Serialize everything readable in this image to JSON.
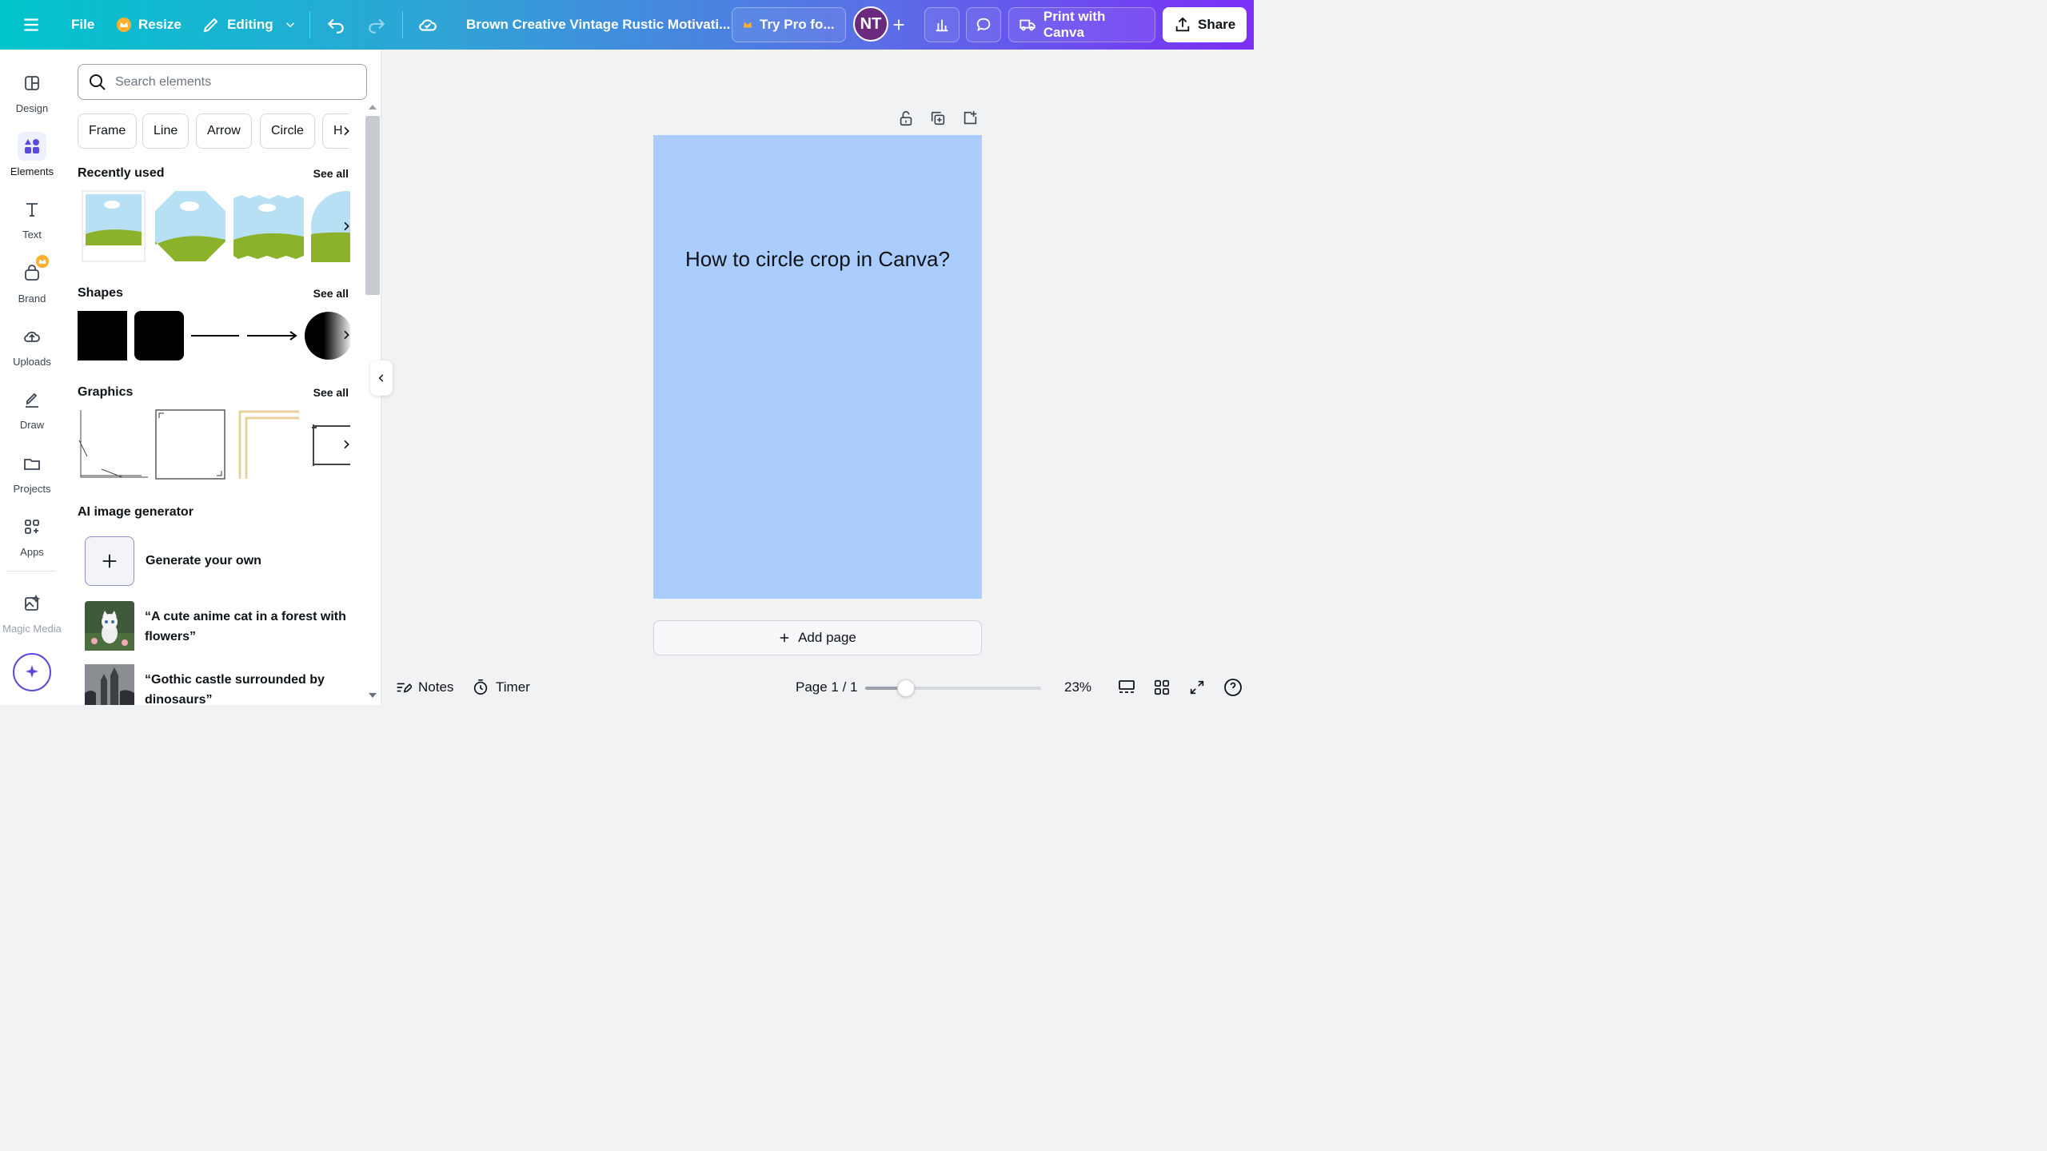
{
  "topbar": {
    "file_label": "File",
    "resize_label": "Resize",
    "editing_label": "Editing",
    "doc_title": "Brown Creative Vintage Rustic Motivati...",
    "try_pro_label": "Try Pro fo...",
    "avatar_initials": "NT",
    "print_label": "Print with Canva",
    "share_label": "Share",
    "accent_gradient": [
      "#00c4cc",
      "#7b2ff7"
    ]
  },
  "rail": {
    "items": [
      {
        "label": "Design",
        "icon": "layout-icon"
      },
      {
        "label": "Elements",
        "icon": "elements-icon"
      },
      {
        "label": "Text",
        "icon": "text-icon"
      },
      {
        "label": "Brand",
        "icon": "brand-icon"
      },
      {
        "label": "Uploads",
        "icon": "upload-cloud-icon"
      },
      {
        "label": "Draw",
        "icon": "pen-icon"
      },
      {
        "label": "Projects",
        "icon": "folder-icon"
      },
      {
        "label": "Apps",
        "icon": "apps-icon"
      },
      {
        "label": "Magic Media",
        "icon": "magic-media-icon"
      }
    ]
  },
  "panel": {
    "search_placeholder": "Search elements",
    "chips": [
      "Frame",
      "Line",
      "Arrow",
      "Circle",
      "H"
    ],
    "recently_used_title": "Recently used",
    "shapes_title": "Shapes",
    "graphics_title": "Graphics",
    "see_all": "See all",
    "ai_title": "AI image generator",
    "generate_label": "Generate your own",
    "prompts": [
      "“A cute anime cat in a forest with flowers”",
      "“Gothic castle surrounded by dinosaurs”"
    ]
  },
  "canvas": {
    "page_text": "How to circle crop in Canva?",
    "page_color": "#abcdfd",
    "add_page_label": "Add page"
  },
  "bottombar": {
    "notes_label": "Notes",
    "timer_label": "Timer",
    "page_indicator": "Page 1 / 1",
    "zoom_label": "23%",
    "zoom_value": 23
  }
}
